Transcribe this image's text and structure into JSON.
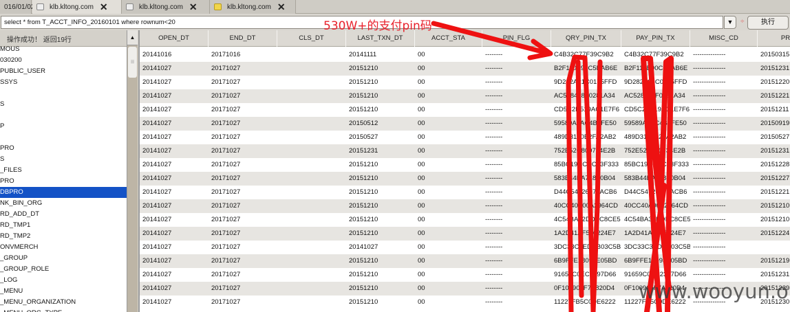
{
  "tabs": [
    {
      "label": "016/01/02",
      "icon": "none"
    },
    {
      "label": "klb.kltong.com",
      "icon": "page-icon",
      "active": true
    },
    {
      "label": "klb.kltong.com",
      "icon": "page-icon"
    },
    {
      "label": "klb.kltong.com",
      "icon": "folder-icon"
    }
  ],
  "query": {
    "value": "select * from T_ACCT_INFO_20160101 where rownum<20",
    "execute_label": "执行",
    "separator": "÷"
  },
  "annotation": "530W+的支付pin码",
  "watermark": "www.wooyun.org",
  "left_panel": {
    "status": "操作成功！ 返回19行",
    "selected_index": 13,
    "items": [
      "MOUS",
      "030200",
      "PUBLIC_USER",
      "SSYS",
      "",
      "S",
      "",
      "P",
      "",
      "PRO",
      "S",
      "_FILES",
      "PRO",
      "DBPRO",
      "NK_BIN_ORG",
      "RD_ADD_DT",
      "RD_TMP1",
      "RD_TMP2",
      "ONVMERCH",
      "_GROUP",
      "_GROUP_ROLE",
      "_LOG",
      "_MENU",
      "_MENU_ORGANIZATION",
      "_MENU_ORG_TYPE"
    ]
  },
  "grid": {
    "columns": [
      "OPEN_DT",
      "END_DT",
      "CLS_DT",
      "LAST_TXN_DT",
      "ACCT_STA",
      "PIN_FLG",
      "QRY_PIN_TX",
      "PAY_PIN_TX",
      "MISC_CD",
      "PREV_"
    ],
    "rows": [
      [
        "20141016",
        "20171016",
        "",
        "20141111",
        "00",
        "--------",
        "C4B32C77F39C9B2",
        "C4B32C77F39C9B2",
        "---------------",
        "20150315"
      ],
      [
        "20141027",
        "20171027",
        "",
        "20151210",
        "00",
        "--------",
        "B2F110E90C5BAB6E",
        "B2F110E90C5BAB6E",
        "---------------",
        "20151231"
      ],
      [
        "20141027",
        "20171027",
        "",
        "20151210",
        "00",
        "--------",
        "9D282A21C0175FFD",
        "9D282A21C0175FFD",
        "---------------",
        "20151220"
      ],
      [
        "20141027",
        "20171027",
        "",
        "20151210",
        "00",
        "--------",
        "AC528428F0281A34",
        "AC528428F0281A34",
        "---------------",
        "20151221"
      ],
      [
        "20141027",
        "20171027",
        "",
        "20151210",
        "00",
        "--------",
        "CD5C2D519AC1E7F6",
        "CD5C2D519AC1E7F6",
        "---------------",
        "20151211"
      ],
      [
        "20141027",
        "20171027",
        "",
        "20150512",
        "00",
        "--------",
        "59589AFAC4B7FE50",
        "59589AFAC4B7FE50",
        "---------------",
        "20150919"
      ],
      [
        "20141027",
        "20171027",
        "",
        "20150527",
        "00",
        "--------",
        "489D3160B2FA2AB2",
        "489D3160B2FA2AB2",
        "---------------",
        "20150527"
      ],
      [
        "20141027",
        "20171027",
        "",
        "20151231",
        "00",
        "--------",
        "752E52C800734E2B",
        "752E52C800734E2B",
        "---------------",
        "20151231"
      ],
      [
        "20141027",
        "20171027",
        "",
        "20151210",
        "00",
        "--------",
        "85BC19CCCC43F333",
        "85BC19CCCC43F333",
        "---------------",
        "20151228"
      ],
      [
        "20141027",
        "20171027",
        "",
        "20151210",
        "00",
        "--------",
        "583B44BA718F0B04",
        "583B44BA718F0B04",
        "---------------",
        "20151227"
      ],
      [
        "20141027",
        "20171027",
        "",
        "20151210",
        "00",
        "--------",
        "D44C54726071ACB6",
        "D44C54726071ACB6",
        "---------------",
        "20151221"
      ],
      [
        "20141027",
        "20171027",
        "",
        "20151210",
        "00",
        "--------",
        "40CC40A00A2964CD",
        "40CC40A00A2964CD",
        "---------------",
        "20151210"
      ],
      [
        "20141027",
        "20171027",
        "",
        "20151210",
        "00",
        "--------",
        "4C54BA32DDBC8CE5",
        "4C54BA32DDBC8CE5",
        "---------------",
        "20151210"
      ],
      [
        "20141027",
        "20171027",
        "",
        "20151210",
        "00",
        "--------",
        "1A2D41AF576224E7",
        "1A2D41AF576224E7",
        "---------------",
        "20151224"
      ],
      [
        "20141027",
        "20171027",
        "",
        "20141027",
        "00",
        "--------",
        "3DC33C3EDDB03C5B",
        "3DC33C3EDDB03C5B",
        "---------------",
        ""
      ],
      [
        "20141027",
        "20171027",
        "",
        "20151210",
        "00",
        "--------",
        "6B9FFE18093E05BD",
        "6B9FFE18093E05BD",
        "---------------",
        "20151219"
      ],
      [
        "20141027",
        "20171027",
        "",
        "20151210",
        "00",
        "--------",
        "91659C0EC2397D66",
        "91659C0EC2397D66",
        "---------------",
        "20151231"
      ],
      [
        "20141027",
        "20171027",
        "",
        "20151210",
        "00",
        "--------",
        "0F100905F7A820D4",
        "0F100905F7A820D4",
        "---------------",
        "20151229"
      ],
      [
        "20141027",
        "20171027",
        "",
        "20151210",
        "00",
        "--------",
        "11227FB5C0DE6222",
        "11227FB5C0DE6222",
        "---------------",
        "20151230"
      ]
    ]
  },
  "colors": {
    "selection": "#1352c6",
    "annotation": "#e8212b",
    "row_alt": "#e7e5e1"
  }
}
